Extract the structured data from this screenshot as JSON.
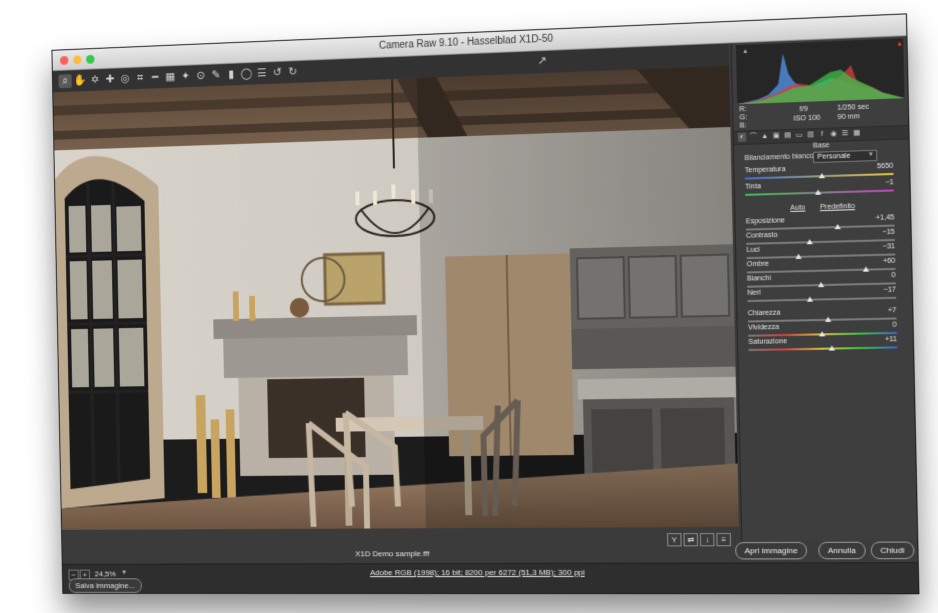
{
  "window": {
    "title": "Camera Raw 9.10  -  Hasselblad X1D-50"
  },
  "toolbar": {
    "tools": [
      {
        "icon": "zoom-icon",
        "glyph": "⌕"
      },
      {
        "icon": "hand-icon",
        "glyph": "✋"
      },
      {
        "icon": "white-balance-icon",
        "glyph": "✡"
      },
      {
        "icon": "color-sampler-icon",
        "glyph": "✚"
      },
      {
        "icon": "target-adjust-icon",
        "glyph": "◎"
      },
      {
        "icon": "crop-icon",
        "glyph": "⌗"
      },
      {
        "icon": "straighten-icon",
        "glyph": "━"
      },
      {
        "icon": "transform-icon",
        "glyph": "▦"
      },
      {
        "icon": "spot-removal-icon",
        "glyph": "✦"
      },
      {
        "icon": "red-eye-icon",
        "glyph": "⊙"
      },
      {
        "icon": "adjustment-brush-icon",
        "glyph": "✎"
      },
      {
        "icon": "graduated-filter-icon",
        "glyph": "▮"
      },
      {
        "icon": "radial-filter-icon",
        "glyph": "◯"
      },
      {
        "icon": "preferences-icon",
        "glyph": "☰"
      },
      {
        "icon": "rotate-left-icon",
        "glyph": "↺"
      },
      {
        "icon": "rotate-right-icon",
        "glyph": "↻"
      }
    ]
  },
  "histogram": {
    "info": {
      "r_label": "R:",
      "g_label": "G:",
      "b_label": "B:",
      "aperture": "f/9",
      "shutter": "1/250 sec",
      "iso": "ISO 100",
      "focal": "90 mm"
    }
  },
  "panel": {
    "tabs": [
      "basic-tab-icon",
      "tone-curve-tab-icon",
      "detail-tab-icon",
      "hsl-tab-icon",
      "split-toning-tab-icon",
      "lens-tab-icon",
      "effects-tab-icon",
      "fx-tab-icon",
      "camera-calibration-tab-icon",
      "presets-tab-icon",
      "snapshots-tab-icon"
    ],
    "section_title": "Base",
    "wb_label": "Bilanciamento bianco:",
    "wb_value": "Personale",
    "auto_label": "Auto",
    "default_label": "Predefinito",
    "sliders": [
      {
        "id": "temperatura",
        "label": "Temperatura",
        "value": "5650",
        "pos": 0.52
      },
      {
        "id": "tinta",
        "label": "Tinta",
        "value": "−1",
        "pos": 0.49
      },
      {
        "id": "esposizione",
        "label": "Esposizione",
        "value": "+1,45",
        "pos": 0.62
      },
      {
        "id": "contrasto",
        "label": "Contrasto",
        "value": "−15",
        "pos": 0.43
      },
      {
        "id": "luci",
        "label": "Luci",
        "value": "−31",
        "pos": 0.35
      },
      {
        "id": "ombre",
        "label": "Ombre",
        "value": "+60",
        "pos": 0.8
      },
      {
        "id": "bianchi",
        "label": "Bianchi",
        "value": "0",
        "pos": 0.5
      },
      {
        "id": "neri",
        "label": "Neri",
        "value": "−17",
        "pos": 0.42
      },
      {
        "id": "chiarezza",
        "label": "Chiarezza",
        "value": "+7",
        "pos": 0.54
      },
      {
        "id": "vividezza",
        "label": "Vividezza",
        "value": "0",
        "pos": 0.5
      },
      {
        "id": "saturazione",
        "label": "Saturazione",
        "value": "+11",
        "pos": 0.56
      }
    ]
  },
  "preview": {
    "filename": "X1D Demo sample.fff"
  },
  "status": {
    "zoom": "24,5%",
    "workflow": "Adobe RGB (1998); 16 bit; 8200 per 6272 (51,3 MB); 300 ppi",
    "save_label": "Salva immagine...",
    "open_label": "Apri immagine",
    "cancel_label": "Annulla",
    "close_label": "Chiudi"
  }
}
